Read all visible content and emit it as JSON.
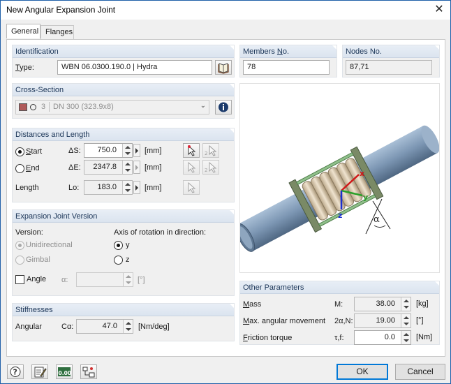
{
  "window": {
    "title": "New Angular Expansion Joint",
    "close_symbol": "✕"
  },
  "tabs": [
    {
      "label": "General",
      "active": true
    },
    {
      "label": "Flanges",
      "active": false
    }
  ],
  "identification": {
    "header": "Identification",
    "type_label": "Type:",
    "type_value": "WBN 06.0300.190.0 | Hydra",
    "library_icon": "book-icon"
  },
  "members": {
    "header": "Members No.",
    "value": "78"
  },
  "nodes": {
    "header": "Nodes No.",
    "value": "87,71"
  },
  "cross_section": {
    "header": "Cross-Section",
    "color": "#b05a5a",
    "number": "3",
    "value": "DN 300 (323.9x8)",
    "info_icon": "info-icon"
  },
  "distances": {
    "header": "Distances and Length",
    "start_label": "Start",
    "start_selected": true,
    "end_label": "End",
    "end_selected": false,
    "ds_label": "ΔS:",
    "ds_value": "750.0",
    "de_label": "ΔE:",
    "de_value": "2347.8",
    "length_label": "Length",
    "lo_label": "Lo:",
    "lo_value": "183.0",
    "unit": "[mm]"
  },
  "version": {
    "header": "Expansion Joint Version",
    "version_label": "Version:",
    "unidirectional": "Unidirectional",
    "gimbal": "Gimbal",
    "axis_label": "Axis of rotation in direction:",
    "axis_y": "y",
    "axis_z": "z",
    "axis_selected": "y",
    "angle_label": "Angle",
    "alpha_label": "α:",
    "angle_unit": "[°]"
  },
  "stiffness": {
    "header": "Stiffnesses",
    "angular_label": "Angular",
    "c_label": "Cα:",
    "value": "47.0",
    "unit": "[Nm/deg]"
  },
  "other": {
    "header": "Other Parameters",
    "mass_label": "Mass",
    "mass_sym": "M:",
    "mass_value": "38.00",
    "mass_unit": "[kg]",
    "angular_label": "Max. angular movement",
    "angular_sym": "2α,N:",
    "angular_value": "19.00",
    "angular_unit": "[°]",
    "friction_label": "Friction torque",
    "friction_sym": "τ,f:",
    "friction_value": "0.0",
    "friction_unit": "[Nm]"
  },
  "preview": {
    "axis_x": "x",
    "axis_y": "y",
    "axis_z": "z",
    "alpha": "α"
  },
  "footer": {
    "ok": "OK",
    "cancel": "Cancel",
    "zero_icon_text": "0.00"
  }
}
